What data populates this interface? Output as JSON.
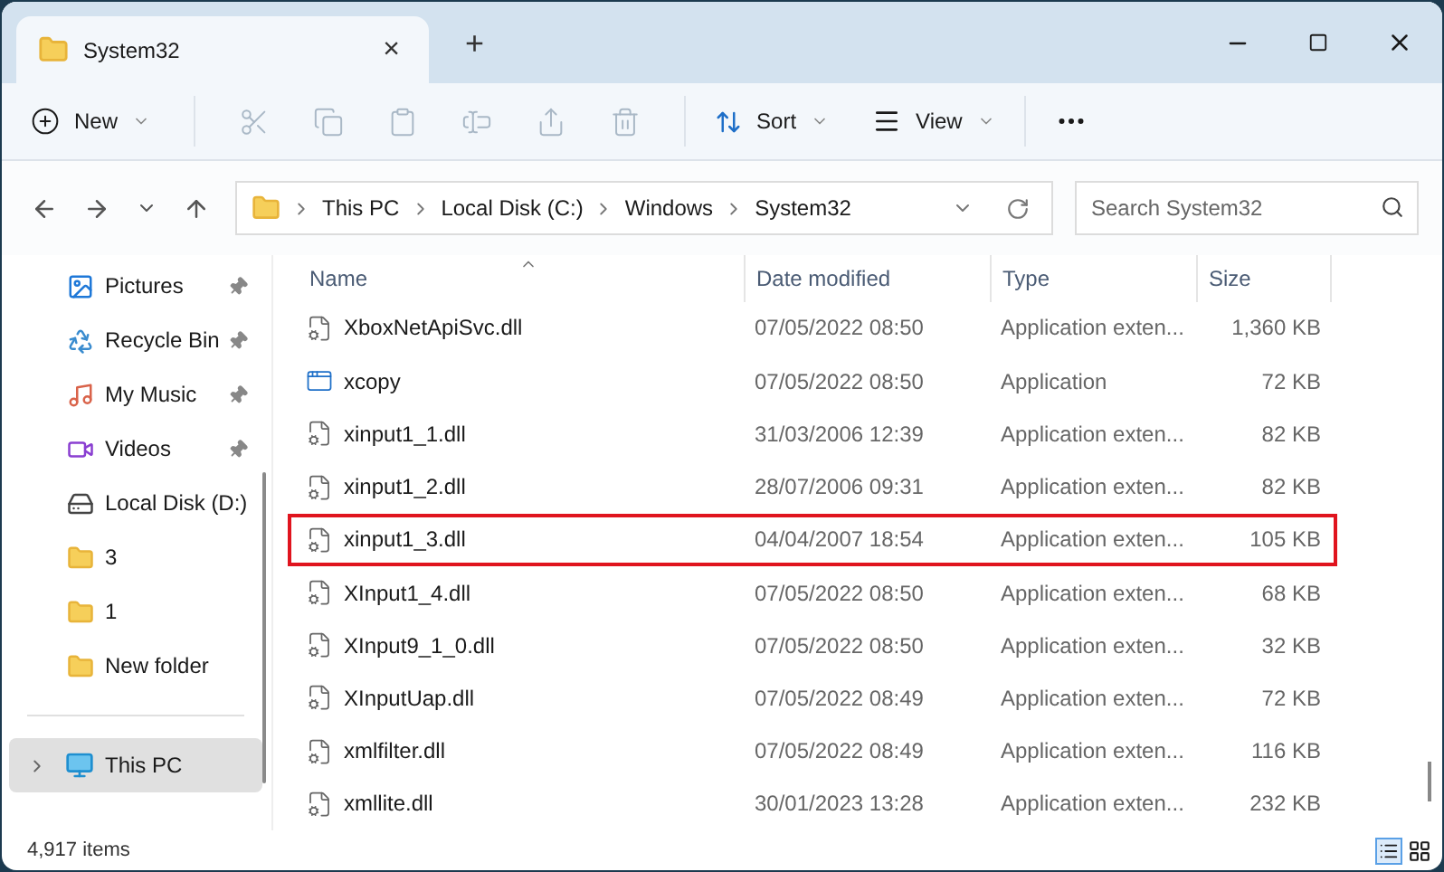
{
  "window": {
    "title": "System32",
    "tab_close": "×",
    "new_tab": "+"
  },
  "toolbar": {
    "new": {
      "label": "New"
    },
    "actions": [
      {
        "kind": "cut",
        "disabled": true
      },
      {
        "kind": "copy",
        "disabled": true
      },
      {
        "kind": "paste",
        "disabled": true
      },
      {
        "kind": "rename",
        "disabled": true
      },
      {
        "kind": "share",
        "disabled": true
      },
      {
        "kind": "delete",
        "disabled": true
      }
    ],
    "sort": {
      "label": "Sort"
    },
    "view": {
      "label": "View"
    }
  },
  "address": {
    "path": [
      "This PC",
      "Local Disk (C:)",
      "Windows",
      "System32"
    ]
  },
  "search": {
    "placeholder": "Search System32"
  },
  "sidebar": {
    "items": [
      {
        "label": "Pictures",
        "kind": "pictures",
        "pinned": true,
        "selected": false
      },
      {
        "label": "Recycle Bin",
        "kind": "recycle",
        "pinned": true,
        "selected": false
      },
      {
        "label": "My Music",
        "kind": "music",
        "pinned": true,
        "selected": false
      },
      {
        "label": "Videos",
        "kind": "videos",
        "pinned": true,
        "selected": false
      },
      {
        "label": "Local Disk (D:)",
        "kind": "drive",
        "pinned": false,
        "selected": false
      },
      {
        "label": "3",
        "kind": "folder",
        "pinned": false,
        "selected": false
      },
      {
        "label": "1",
        "kind": "folder",
        "pinned": false,
        "selected": false
      },
      {
        "label": "New folder",
        "kind": "folder",
        "pinned": false,
        "selected": false
      }
    ],
    "bottom_items": [
      {
        "label": "This PC",
        "kind": "pc",
        "selected": true
      }
    ]
  },
  "table": {
    "columns": [
      "Name",
      "Date modified",
      "Type",
      "Size"
    ],
    "rows": [
      {
        "name": "XboxNetApiSvc.dll",
        "date": "07/05/2022 08:50",
        "type": "Application exten...",
        "size": "1,360 KB",
        "kind": "dll",
        "highlighted": false
      },
      {
        "name": "xcopy",
        "date": "07/05/2022 08:50",
        "type": "Application",
        "size": "72 KB",
        "kind": "exe",
        "highlighted": false
      },
      {
        "name": "xinput1_1.dll",
        "date": "31/03/2006 12:39",
        "type": "Application exten...",
        "size": "82 KB",
        "kind": "dll",
        "highlighted": false
      },
      {
        "name": "xinput1_2.dll",
        "date": "28/07/2006 09:31",
        "type": "Application exten...",
        "size": "82 KB",
        "kind": "dll",
        "highlighted": false
      },
      {
        "name": "xinput1_3.dll",
        "date": "04/04/2007 18:54",
        "type": "Application exten...",
        "size": "105 KB",
        "kind": "dll",
        "highlighted": true
      },
      {
        "name": "XInput1_4.dll",
        "date": "07/05/2022 08:50",
        "type": "Application exten...",
        "size": "68 KB",
        "kind": "dll",
        "highlighted": false
      },
      {
        "name": "XInput9_1_0.dll",
        "date": "07/05/2022 08:50",
        "type": "Application exten...",
        "size": "32 KB",
        "kind": "dll",
        "highlighted": false
      },
      {
        "name": "XInputUap.dll",
        "date": "07/05/2022 08:49",
        "type": "Application exten...",
        "size": "72 KB",
        "kind": "dll",
        "highlighted": false
      },
      {
        "name": "xmlfilter.dll",
        "date": "07/05/2022 08:49",
        "type": "Application exten...",
        "size": "116 KB",
        "kind": "dll",
        "highlighted": false
      },
      {
        "name": "xmllite.dll",
        "date": "30/01/2023 13:28",
        "type": "Application exten...",
        "size": "232 KB",
        "kind": "dll",
        "highlighted": false
      }
    ]
  },
  "status_bar": {
    "count": "4,917 items",
    "views": [
      {
        "kind": "details",
        "selected": true
      },
      {
        "kind": "tiles",
        "selected": false
      }
    ]
  }
}
